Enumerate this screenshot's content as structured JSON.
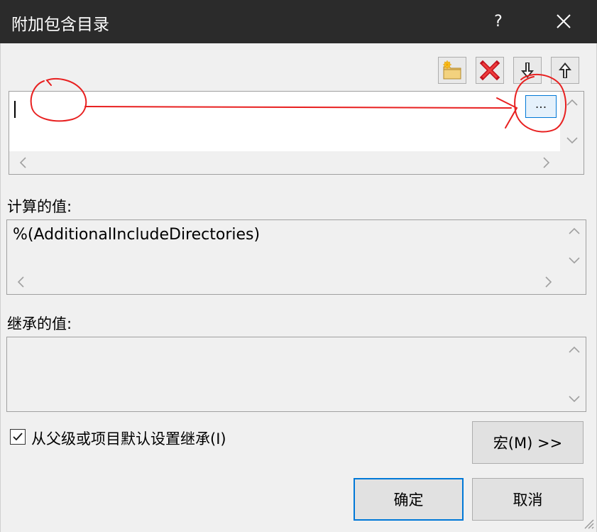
{
  "dialog": {
    "title": "附加包含目录",
    "help_label": "?"
  },
  "toolbar": {
    "new_line_icon": "new-folder-icon",
    "delete_icon": "delete-x-icon",
    "move_down_icon": "arrow-down-icon",
    "move_up_icon": "arrow-up-icon"
  },
  "edit_list": {
    "current_value": "",
    "browse_label": "..."
  },
  "evaluated": {
    "label": "计算的值:",
    "value": "%(AdditionalIncludeDirectories)"
  },
  "inherited": {
    "label": "继承的值:",
    "value": ""
  },
  "inherit_checkbox": {
    "label": "从父级或项目默认设置继承(I)",
    "checked": true
  },
  "buttons": {
    "macros": "宏(M) >>",
    "ok": "确定",
    "cancel": "取消"
  },
  "colors": {
    "titlebar": "#2b2b2b",
    "accent": "#0078d7",
    "annotation": "#e82020"
  }
}
